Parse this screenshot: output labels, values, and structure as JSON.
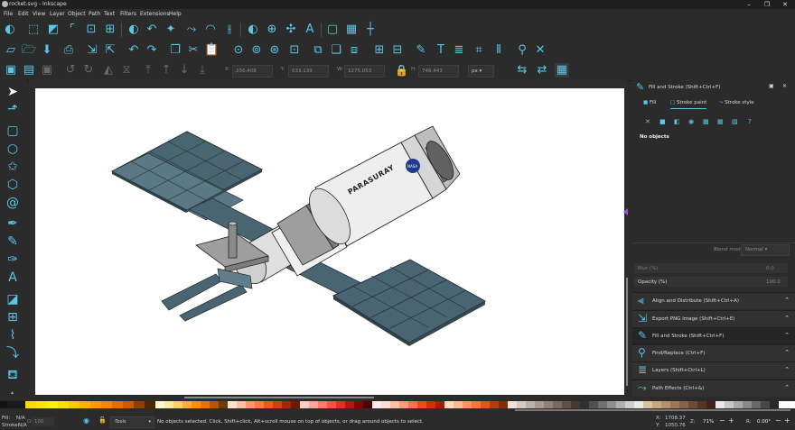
{
  "window": {
    "title": "rocket.svg - Inkscape",
    "controls": [
      "minimize",
      "maximize",
      "close"
    ]
  },
  "menu": [
    "File",
    "Edit",
    "View",
    "Layer",
    "Object",
    "Path",
    "Text",
    "Filters",
    "Extensions",
    "Help"
  ],
  "toolbar_coords": {
    "x_label": "X:",
    "x_value": "256.408",
    "y_label": "Y:",
    "y_value": "633.139",
    "w_label": "W:",
    "w_value": "1275.053",
    "h_label": "H:",
    "h_value": "746.443",
    "unit": "px"
  },
  "fill_stroke_panel": {
    "title": "Fill and Stroke (Shift+Ctrl+F)",
    "tabs": [
      "Fill",
      "Stroke paint",
      "Stroke style"
    ],
    "status": "No objects",
    "blend_label": "Blend mode:",
    "blend_value": "Normal",
    "blur_label": "Blur (%)",
    "blur_value": "0.0",
    "opacity_label": "Opacity (%)",
    "opacity_value": "100.0"
  },
  "docked_dialogs": [
    {
      "label": "Align and Distribute (Shift+Ctrl+A)",
      "icon": "align-icon"
    },
    {
      "label": "Export PNG Image (Shift+Ctrl+E)",
      "icon": "export-icon"
    },
    {
      "label": "Fill and Stroke (Shift+Ctrl+F)",
      "icon": "fill-stroke-icon"
    },
    {
      "label": "Find/Replace (Ctrl+F)",
      "icon": "find-icon"
    },
    {
      "label": "Layers (Shift+Ctrl+L)",
      "icon": "layers-icon"
    },
    {
      "label": "Path Effects (Ctrl+&)",
      "icon": "path-effects-icon"
    }
  ],
  "artwork": {
    "station_label": "PARASURAY"
  },
  "status": {
    "fill_label": "Fill:",
    "fill_value": "N/A",
    "stroke_label": "Stroke:",
    "stroke_value": "N/A",
    "opacity_label": "O:",
    "opacity_value": "100",
    "layer": "-Tools",
    "message": "No objects selected. Click, Shift+click, Alt+scroll mouse on top of objects, or drag around objects to select.",
    "x_label": "X:",
    "x_value": "1708.37",
    "y_label": "Y:",
    "y_value": "1050.76",
    "zoom_label": "Z:",
    "zoom_value": "71%",
    "rotation_label": "R:",
    "rotation_value": "0.00°"
  },
  "colors": {
    "accent": "#59c8e8",
    "bg": "#2b2b2b",
    "panel_blue": "#4a6572",
    "panel_blue_light": "#5f7f8c"
  }
}
